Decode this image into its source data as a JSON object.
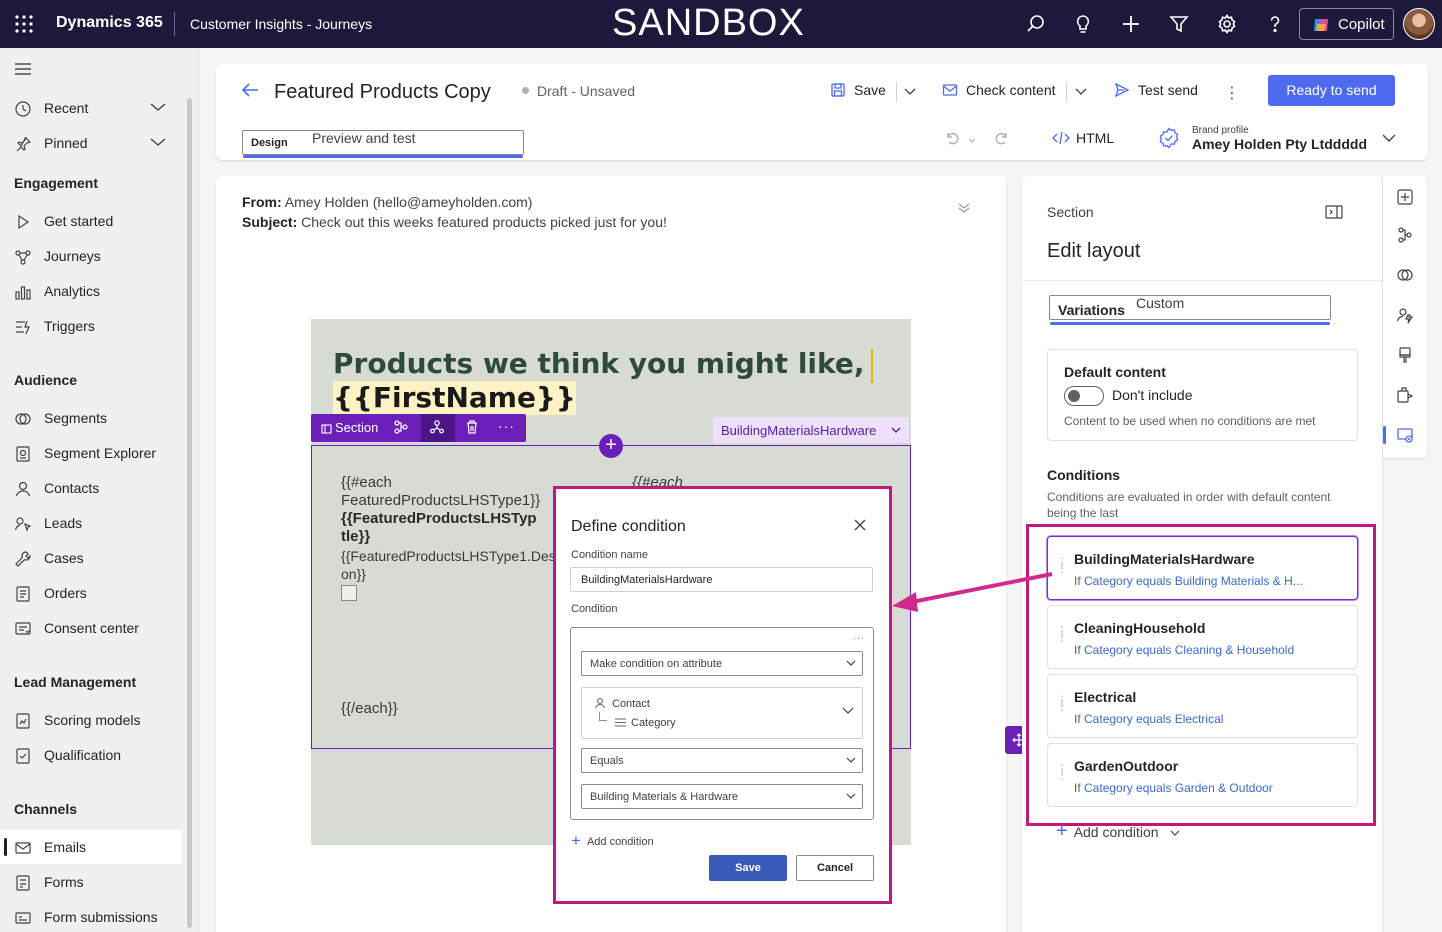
{
  "topbar": {
    "app_name": "Dynamics 365",
    "area_name": "Customer Insights - Journeys",
    "environment_banner": "SANDBOX",
    "copilot_label": "Copilot",
    "icons": [
      "waffle-icon",
      "search-icon",
      "lightbulb-icon",
      "plus-icon",
      "filter-icon",
      "settings-icon",
      "help-icon"
    ]
  },
  "sidebar": {
    "top_items": [
      {
        "label": "Recent",
        "icon": "clock-icon"
      },
      {
        "label": "Pinned",
        "icon": "pin-icon"
      }
    ],
    "groups": [
      {
        "title": "Engagement",
        "items": [
          {
            "label": "Get started",
            "icon": "play-icon"
          },
          {
            "label": "Journeys",
            "icon": "journeys-icon"
          },
          {
            "label": "Analytics",
            "icon": "analytics-icon"
          },
          {
            "label": "Triggers",
            "icon": "triggers-icon"
          }
        ]
      },
      {
        "title": "Audience",
        "items": [
          {
            "label": "Segments",
            "icon": "segments-icon"
          },
          {
            "label": "Segment Explorer",
            "icon": "segment-explorer-icon"
          },
          {
            "label": "Contacts",
            "icon": "person-icon"
          },
          {
            "label": "Leads",
            "icon": "leads-icon"
          },
          {
            "label": "Cases",
            "icon": "wrench-icon"
          },
          {
            "label": "Orders",
            "icon": "document-icon"
          },
          {
            "label": "Consent center",
            "icon": "consent-icon"
          }
        ]
      },
      {
        "title": "Lead Management",
        "items": [
          {
            "label": "Scoring models",
            "icon": "scoring-icon"
          },
          {
            "label": "Qualification",
            "icon": "qualification-icon"
          }
        ]
      },
      {
        "title": "Channels",
        "items": [
          {
            "label": "Emails",
            "icon": "mail-icon",
            "active": true
          },
          {
            "label": "Forms",
            "icon": "forms-icon"
          },
          {
            "label": "Form submissions",
            "icon": "form-submissions-icon"
          }
        ]
      }
    ]
  },
  "header": {
    "title": "Featured Products Copy",
    "status": "Draft - Unsaved",
    "save_label": "Save",
    "check_content_label": "Check content",
    "test_send_label": "Test send",
    "ready_label": "Ready to send",
    "tabs": [
      {
        "label": "Design",
        "selected": true
      },
      {
        "label": "Preview and test",
        "selected": false
      }
    ],
    "html_label": "HTML",
    "brand_profile_caption": "Brand profile",
    "brand_profile_name": "Amey Holden Pty Ltddddd"
  },
  "email": {
    "from_label": "From:",
    "from_value": "Amey Holden (hello@ameyholden.com)",
    "subject_label": "Subject:",
    "subject_value": "Check out this weeks featured products picked just for you!",
    "headline": "Products we think you might like,",
    "first_name_token": "{{FirstName}}",
    "section_toolbar_label": "Section",
    "variation_chip": "BuildingMaterialsHardware",
    "add_symbol": "+",
    "left_col": {
      "each_open": "{{#each",
      "each_arg": "FeaturedProductsLHSType1}}",
      "title_token_1": "{{FeaturedProductsLHSTyp",
      "title_token_2": "tle}}",
      "desc_token_1": "{{FeaturedProductsLHSType1.Des",
      "desc_token_2": "on}}",
      "each_close": "{{/each}}"
    },
    "right_col": {
      "each_open": "{{#each"
    }
  },
  "dialog": {
    "title": "Define condition",
    "condition_name_label": "Condition name",
    "condition_name_value": "BuildingMaterialsHardware",
    "condition_label": "Condition",
    "more_symbol": "...",
    "type_select": "Make condition on attribute",
    "attribute_entity": "Contact",
    "attribute_field": "Category",
    "operator_select": "Equals",
    "value_select": "Building Materials & Hardware",
    "add_condition_label": "Add condition",
    "save_label": "Save",
    "cancel_label": "Cancel"
  },
  "panel": {
    "section_label": "Section",
    "title": "Edit layout",
    "tabs": [
      {
        "label": "Variations",
        "selected": true
      },
      {
        "label": "Custom",
        "selected": false
      }
    ],
    "default_content": {
      "title": "Default content",
      "toggle_label": "Don't include",
      "toggle_on": false,
      "description": "Content to be used when no conditions are met"
    },
    "conditions_title": "Conditions",
    "conditions_description": "Conditions are evaluated in order with default content being the last",
    "conditions": [
      {
        "name": "BuildingMaterialsHardware",
        "prefix": "If",
        "rule": "Category equals Building Materials & H...",
        "selected": true
      },
      {
        "name": "CleaningHousehold",
        "prefix": "If",
        "rule": "Category equals Cleaning & Household",
        "selected": false
      },
      {
        "name": "Electrical",
        "prefix": "If",
        "rule": "Category equals Electrical",
        "selected": false
      },
      {
        "name": "GardenOutdoor",
        "prefix": "If",
        "rule": "Category equals Garden & Outdoor",
        "selected": false
      }
    ],
    "add_condition_label": "Add condition"
  },
  "colors": {
    "topbar_bg": "#1b1a3a",
    "accent": "#4f6bed",
    "section_purple": "#6b1fb8",
    "highlight_magenta": "#c4177e",
    "email_bg": "#d6dcd4",
    "headline_green": "#2f4a3c"
  }
}
